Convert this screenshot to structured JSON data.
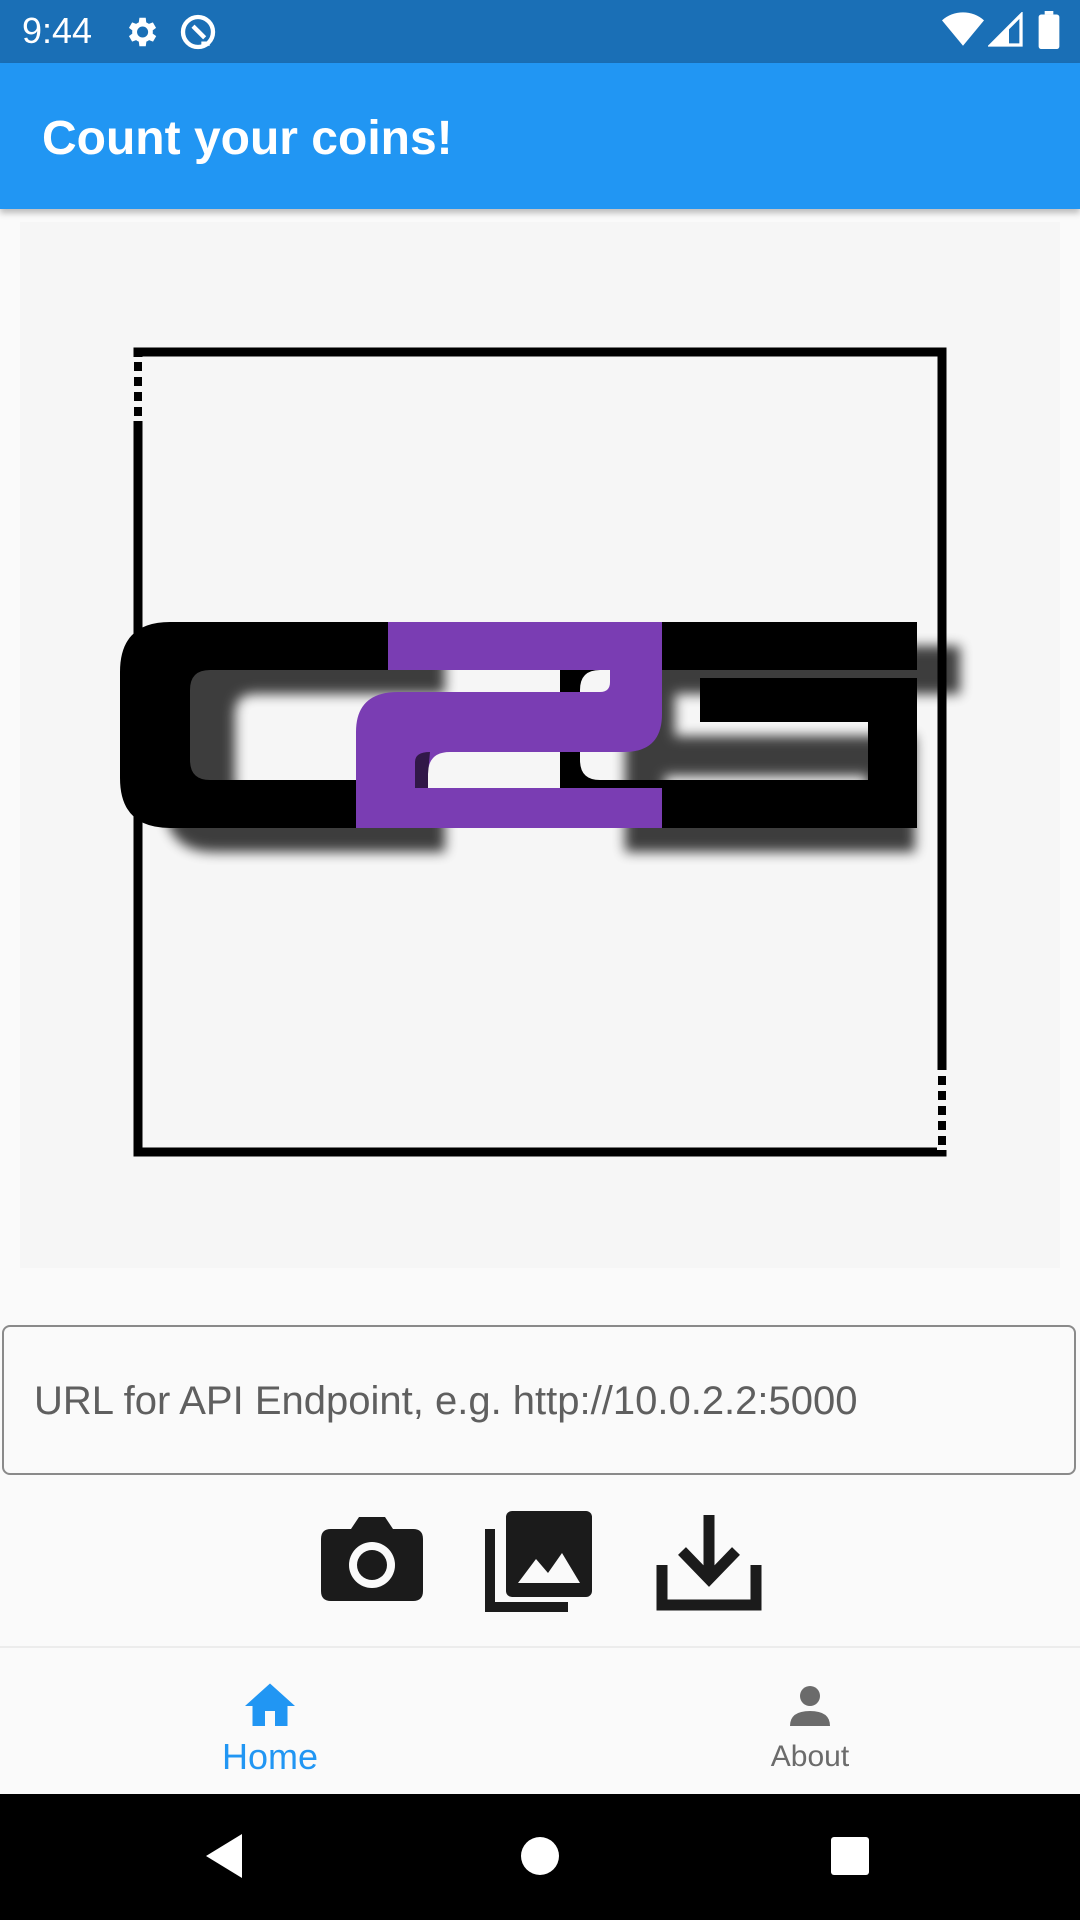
{
  "status_bar": {
    "time": "9:44",
    "icons": [
      "settings-gear-icon",
      "sync-q-icon",
      "wifi-icon",
      "cell-signal-icon",
      "battery-icon"
    ]
  },
  "app_bar": {
    "title": "Count your coins!",
    "color": "#2196f3"
  },
  "logo": {
    "text": "C2G",
    "accent_color": "#7a3db3"
  },
  "url_input": {
    "placeholder": "URL for API Endpoint, e.g. http://10.0.2.2:5000",
    "value": ""
  },
  "actions": {
    "icons": [
      "camera-icon",
      "photo-library-icon",
      "download-icon"
    ]
  },
  "bottom_nav": {
    "items": [
      {
        "label": "Home",
        "icon": "home-icon",
        "selected": true
      },
      {
        "label": "About",
        "icon": "person-icon",
        "selected": false
      }
    ],
    "active_color": "#2196f3"
  },
  "system_nav": {
    "icons": [
      "back-icon",
      "home-circle-icon",
      "recents-icon"
    ]
  }
}
